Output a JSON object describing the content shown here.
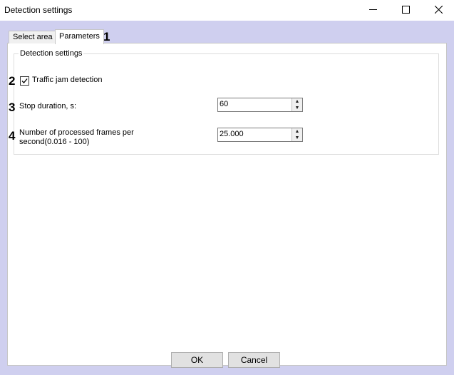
{
  "window": {
    "title": "Detection settings",
    "controls": {
      "minimize": "minimize-icon",
      "maximize": "maximize-icon",
      "close": "close-icon"
    }
  },
  "tabs": [
    {
      "label": "Select area",
      "active": false
    },
    {
      "label": "Parameters",
      "active": true
    }
  ],
  "annotations": [
    "1",
    "2",
    "3",
    "4"
  ],
  "group": {
    "legend": "Detection settings",
    "traffic_jam": {
      "label": "Traffic jam detection",
      "checked": true
    },
    "stop_duration": {
      "label": "Stop duration, s:",
      "value": "60"
    },
    "frames": {
      "label_line1": "Number of processed frames per",
      "label_line2": "second(0.016 - 100)",
      "value": "25.000"
    }
  },
  "buttons": {
    "ok": "OK",
    "cancel": "Cancel"
  },
  "colors": {
    "client_bg": "#cfcfef",
    "panel_bg": "#ffffff",
    "button_bg": "#e1e1e1"
  }
}
